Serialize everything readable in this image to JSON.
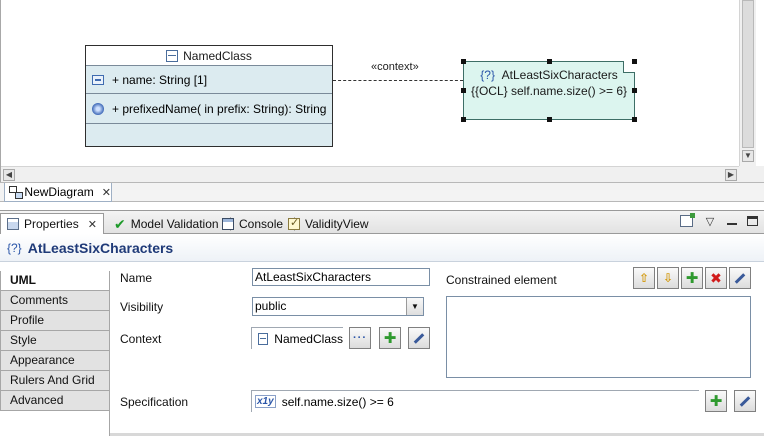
{
  "diagram": {
    "class": {
      "name": "NamedClass",
      "attribute": "+ name: String [1]",
      "operation": "+ prefixedName(  in prefix: String): String"
    },
    "connector_label": "«context»",
    "constraint": {
      "icon_text": "{?}",
      "name": "AtLeastSixCharacters",
      "spec": "{{OCL} self.name.size() >= 6}"
    }
  },
  "editor": {
    "tab_label": "NewDiagram",
    "close_glyph": "✕"
  },
  "views": {
    "tabs": [
      {
        "label": "Properties",
        "icon": "properties-icon",
        "active": true
      },
      {
        "label": "Model Validation",
        "icon": "check-icon",
        "active": false
      },
      {
        "label": "Console",
        "icon": "console-icon",
        "active": false
      },
      {
        "label": "ValidityView",
        "icon": "validity-icon",
        "active": false
      }
    ],
    "close_glyph": "✕",
    "menu_glyph": "▽"
  },
  "properties": {
    "title_icon": "{?}",
    "title": "AtLeastSixCharacters",
    "side_tabs": [
      "UML",
      "Comments",
      "Profile",
      "Style",
      "Appearance",
      "Rulers And Grid",
      "Advanced"
    ],
    "active_side_tab": "UML",
    "name_label": "Name",
    "name_value": "AtLeastSixCharacters",
    "visibility_label": "Visibility",
    "visibility_value": "public",
    "context_label": "Context",
    "context_value": "NamedClass",
    "constrained_label": "Constrained element",
    "specification_label": "Specification",
    "specification_icon": "x1y",
    "specification_value": "self.name.size() >= 6"
  },
  "colors": {
    "constraint_fill": "#dcf5ef",
    "class_compartment": "#dcebf0",
    "title_text": "#1f3a78"
  }
}
